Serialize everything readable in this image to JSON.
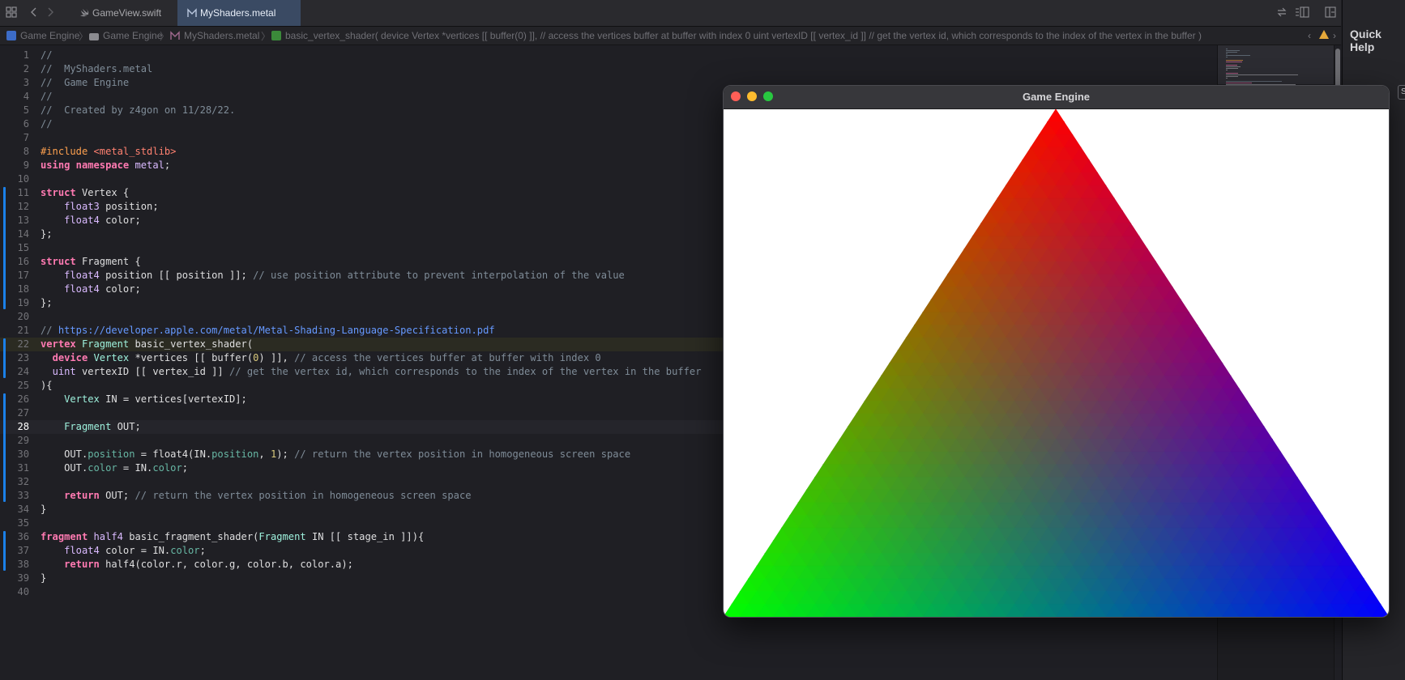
{
  "colors": {
    "accent_blue": "#1b80e8",
    "tab_active": "#3a4a63",
    "editor_bg": "#1f1f24",
    "keyword": "#ff7ab2",
    "comment": "#7f8c98",
    "type": "#dabaff",
    "preprocessor": "#ffa14f",
    "string": "#ff8170",
    "url": "#6699ff",
    "vertex_top": "#ff0000",
    "vertex_left": "#00ff00",
    "vertex_right": "#0000ff"
  },
  "toolbar": {
    "grid_icon": "grid-icon",
    "back_icon": "chevron-left-icon",
    "forward_icon": "chevron-right-icon",
    "right_icons": [
      "refresh-icon",
      "inspector-icon",
      "add-editor-icon"
    ]
  },
  "tabs": [
    {
      "label": "GameView.swift",
      "icon": "swift-file-icon",
      "active": false
    },
    {
      "label": "MyShaders.metal",
      "icon": "metal-file-icon",
      "active": true
    }
  ],
  "breadcrumb": [
    {
      "label": "Game Engine",
      "icon": "project-icon"
    },
    {
      "label": "Game Engine",
      "icon": "folder-icon"
    },
    {
      "label": "MyShaders.metal",
      "icon": "metal-file-icon"
    },
    {
      "label": "basic_vertex_shader( device Vertex *vertices [[ buffer(0) ]], // access the vertices buffer at buffer with index 0 uint vertexID [[ vertex_id ]] // get the vertex id, which corresponds to the index of the vertex in the buffer )",
      "icon": "function-icon"
    }
  ],
  "breadcrumb_right_icons": [
    "chevron-left-icon",
    "warning-icon",
    "chevron-right-icon"
  ],
  "quick_help": {
    "title": "Quick Help",
    "button": "S"
  },
  "code": [
    {
      "n": "1",
      "t": [
        [
          "cmt",
          "//"
        ]
      ]
    },
    {
      "n": "2",
      "t": [
        [
          "cmt",
          "//  MyShaders.metal"
        ]
      ]
    },
    {
      "n": "3",
      "t": [
        [
          "cmt",
          "//  Game Engine"
        ]
      ]
    },
    {
      "n": "4",
      "t": [
        [
          "cmt",
          "//"
        ]
      ]
    },
    {
      "n": "5",
      "t": [
        [
          "cmt",
          "//  Created by z4gon on 11/28/22."
        ]
      ]
    },
    {
      "n": "6",
      "t": [
        [
          "cmt",
          "//"
        ]
      ]
    },
    {
      "n": "7",
      "t": []
    },
    {
      "n": "8",
      "t": [
        [
          "pp",
          "#include "
        ],
        [
          "str",
          "<metal_stdlib>"
        ]
      ]
    },
    {
      "n": "9",
      "t": [
        [
          "kw",
          "using namespace "
        ],
        [
          "typ",
          "metal"
        ],
        [
          "",
          ";"
        ]
      ]
    },
    {
      "n": "10",
      "t": []
    },
    {
      "n": "11",
      "t": [
        [
          "kw",
          "struct "
        ],
        [
          "",
          "Vertex {"
        ]
      ]
    },
    {
      "n": "12",
      "t": [
        [
          "",
          "    "
        ],
        [
          "typ",
          "float3"
        ],
        [
          "",
          " position;"
        ]
      ]
    },
    {
      "n": "13",
      "t": [
        [
          "",
          "    "
        ],
        [
          "typ",
          "float4"
        ],
        [
          "",
          " color;"
        ]
      ]
    },
    {
      "n": "14",
      "t": [
        [
          "",
          "};"
        ]
      ]
    },
    {
      "n": "15",
      "t": []
    },
    {
      "n": "16",
      "t": [
        [
          "kw",
          "struct "
        ],
        [
          "",
          "Fragment {"
        ]
      ]
    },
    {
      "n": "17",
      "t": [
        [
          "",
          "    "
        ],
        [
          "typ",
          "float4"
        ],
        [
          "",
          " position [[ position ]]; "
        ],
        [
          "cmt",
          "// use position attribute to prevent interpolation of the value"
        ]
      ]
    },
    {
      "n": "18",
      "t": [
        [
          "",
          "    "
        ],
        [
          "typ",
          "float4"
        ],
        [
          "",
          " color;"
        ]
      ]
    },
    {
      "n": "19",
      "t": [
        [
          "",
          "};"
        ]
      ]
    },
    {
      "n": "20",
      "t": []
    },
    {
      "n": "21",
      "t": [
        [
          "cmt",
          "// "
        ],
        [
          "url",
          "https://developer.apple.com/metal/Metal-Shading-Language-Specification.pdf"
        ]
      ]
    },
    {
      "n": "22",
      "t": [
        [
          "kw",
          "vertex "
        ],
        [
          "usr",
          "Fragment "
        ],
        [
          "",
          "basic_vertex_shader("
        ]
      ]
    },
    {
      "n": "23",
      "t": [
        [
          "",
          "  "
        ],
        [
          "kw",
          "device "
        ],
        [
          "usr",
          "Vertex "
        ],
        [
          "",
          "*vertices [[ buffer("
        ],
        [
          "num",
          "0"
        ],
        [
          "",
          ") ]], "
        ],
        [
          "cmt",
          "// access the vertices buffer at buffer with index 0"
        ]
      ]
    },
    {
      "n": "24",
      "t": [
        [
          "",
          "  "
        ],
        [
          "typ",
          "uint"
        ],
        [
          "",
          " vertexID [[ vertex_id ]] "
        ],
        [
          "cmt",
          "// get the vertex id, which corresponds to the index of the vertex in the buffer"
        ]
      ]
    },
    {
      "n": "25",
      "t": [
        [
          "",
          "){"
        ]
      ]
    },
    {
      "n": "26",
      "t": [
        [
          "",
          "    "
        ],
        [
          "usr",
          "Vertex "
        ],
        [
          "",
          "IN = vertices[vertexID];"
        ]
      ]
    },
    {
      "n": "27",
      "t": []
    },
    {
      "n": "28",
      "t": [
        [
          "",
          "    "
        ],
        [
          "usr",
          "Fragment "
        ],
        [
          "",
          "OUT;"
        ]
      ]
    },
    {
      "n": "29",
      "t": []
    },
    {
      "n": "30",
      "t": [
        [
          "",
          "    OUT."
        ],
        [
          "fld",
          "position"
        ],
        [
          "",
          " = float4(IN."
        ],
        [
          "fld",
          "position"
        ],
        [
          "",
          ", "
        ],
        [
          "num",
          "1"
        ],
        [
          "",
          "); "
        ],
        [
          "cmt",
          "// return the vertex position in homogeneous screen space"
        ]
      ]
    },
    {
      "n": "31",
      "t": [
        [
          "",
          "    OUT."
        ],
        [
          "fld",
          "color"
        ],
        [
          "",
          " = IN."
        ],
        [
          "fld",
          "color"
        ],
        [
          "",
          ";"
        ]
      ]
    },
    {
      "n": "32",
      "t": []
    },
    {
      "n": "33",
      "t": [
        [
          "",
          "    "
        ],
        [
          "kw",
          "return "
        ],
        [
          "",
          "OUT; "
        ],
        [
          "cmt",
          "// return the vertex position in homogeneous screen space"
        ]
      ]
    },
    {
      "n": "34",
      "t": [
        [
          "",
          "}"
        ]
      ]
    },
    {
      "n": "35",
      "t": []
    },
    {
      "n": "36",
      "t": [
        [
          "kw",
          "fragment "
        ],
        [
          "typ",
          "half4"
        ],
        [
          "",
          " basic_fragment_shader("
        ],
        [
          "usr",
          "Fragment "
        ],
        [
          "",
          "IN [[ stage_in ]]){"
        ]
      ]
    },
    {
      "n": "37",
      "t": [
        [
          "",
          "    "
        ],
        [
          "typ",
          "float4"
        ],
        [
          "",
          " color = IN."
        ],
        [
          "fld",
          "color"
        ],
        [
          "",
          ";"
        ]
      ]
    },
    {
      "n": "38",
      "t": [
        [
          "",
          "    "
        ],
        [
          "kw",
          "return "
        ],
        [
          "",
          "half4(color.r, color.g, color.b, color.a);"
        ]
      ]
    },
    {
      "n": "39",
      "t": [
        [
          "",
          "}"
        ]
      ]
    },
    {
      "n": "40",
      "t": []
    }
  ],
  "change_marks": [
    [
      11,
      19
    ],
    [
      22,
      24
    ],
    [
      26,
      33
    ],
    [
      36,
      38
    ]
  ],
  "highlighted_line": 22,
  "current_line": 28,
  "game_window": {
    "title": "Game Engine",
    "lights": [
      "close-icon",
      "minimize-icon",
      "zoom-icon"
    ]
  }
}
